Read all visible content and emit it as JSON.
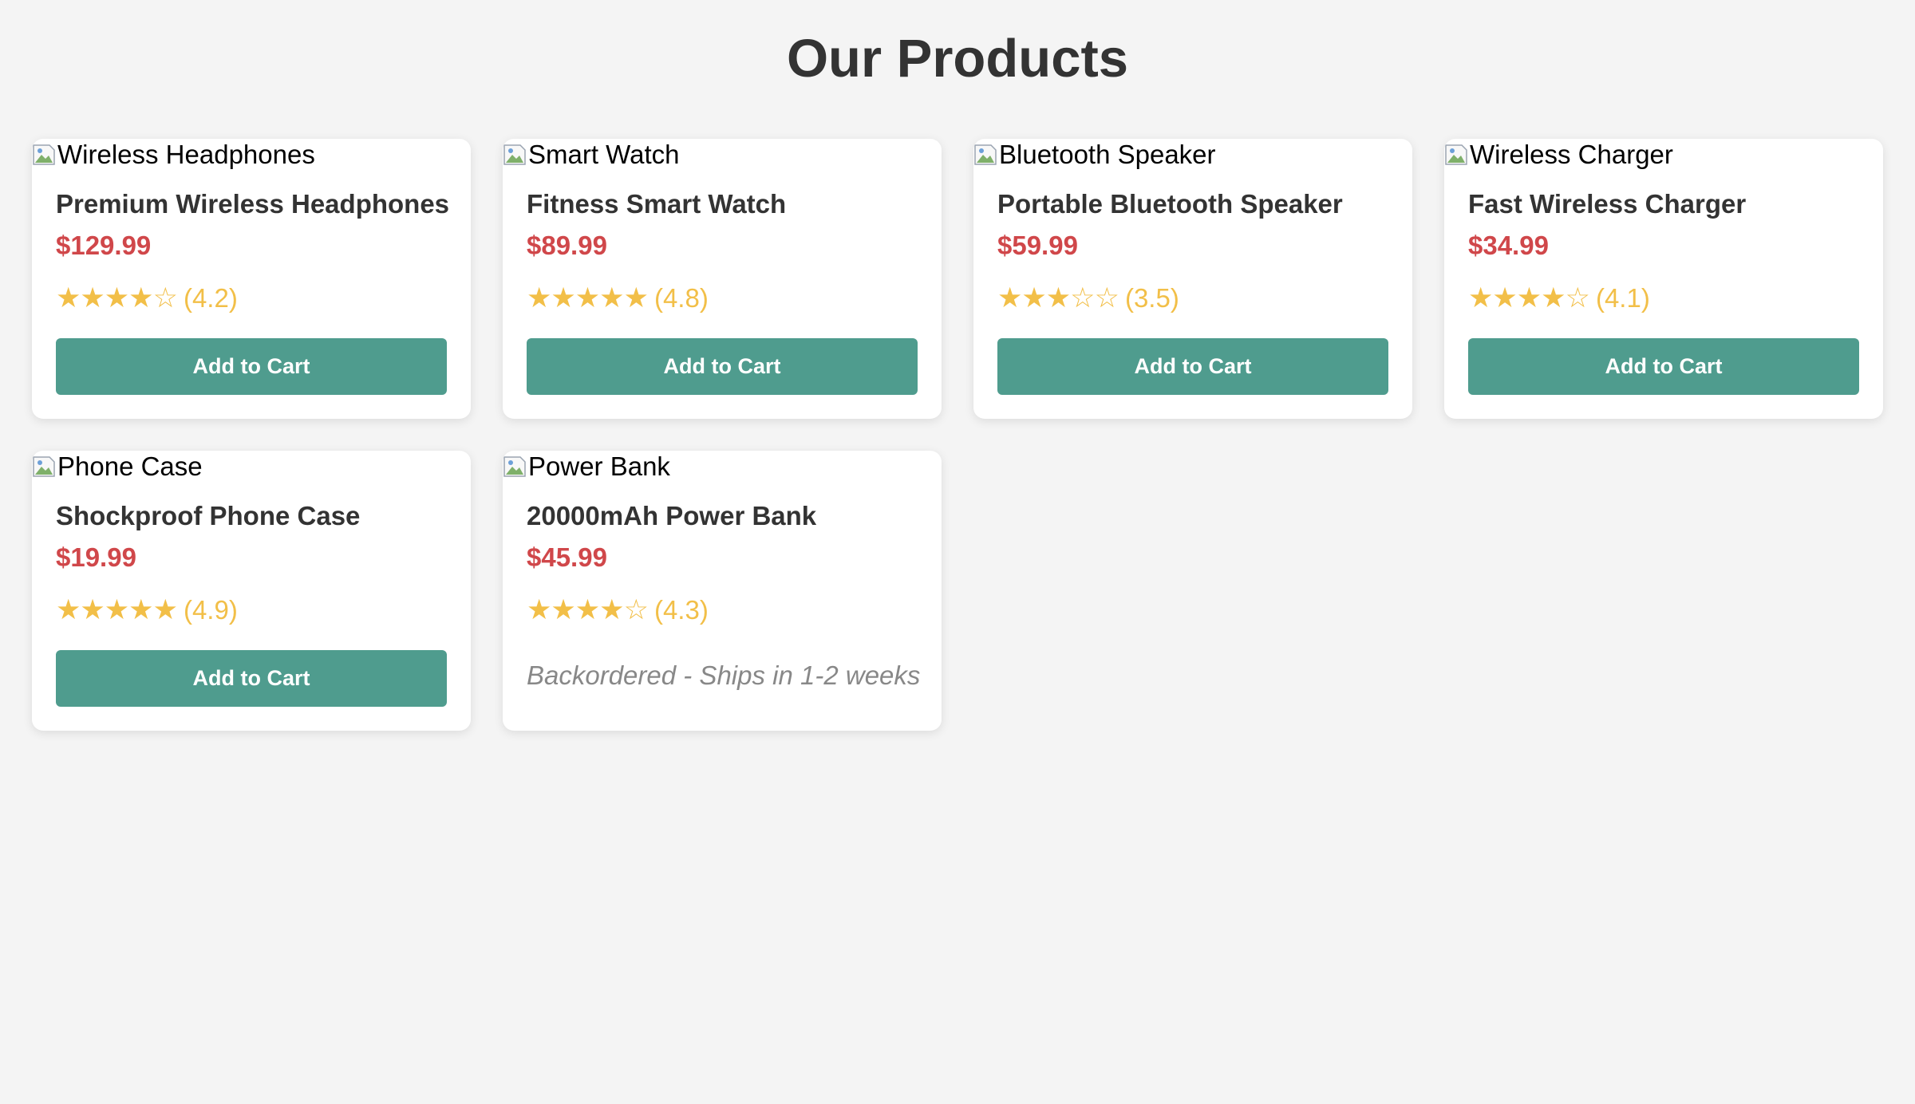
{
  "page": {
    "title": "Our Products"
  },
  "theme": {
    "background": "#f4f4f4",
    "card_background": "#ffffff",
    "price_color": "#d0474a",
    "star_color": "#f2bf48",
    "button_color": "#4f9c8e",
    "muted_text_color": "#888888"
  },
  "products": [
    {
      "image_alt": "Wireless Headphones",
      "name": "Premium Wireless Headphones",
      "price": "$129.99",
      "rating": 4.2,
      "rating_label": "(4.2)",
      "stars_filled": 4,
      "stars_total": 5,
      "action_label": "Add to Cart",
      "status": ""
    },
    {
      "image_alt": "Smart Watch",
      "name": "Fitness Smart Watch",
      "price": "$89.99",
      "rating": 4.8,
      "rating_label": "(4.8)",
      "stars_filled": 5,
      "stars_total": 5,
      "action_label": "Add to Cart",
      "status": ""
    },
    {
      "image_alt": "Bluetooth Speaker",
      "name": "Portable Bluetooth Speaker",
      "price": "$59.99",
      "rating": 3.5,
      "rating_label": "(3.5)",
      "stars_filled": 3,
      "stars_total": 5,
      "action_label": "Add to Cart",
      "status": ""
    },
    {
      "image_alt": "Wireless Charger",
      "name": "Fast Wireless Charger",
      "price": "$34.99",
      "rating": 4.1,
      "rating_label": "(4.1)",
      "stars_filled": 4,
      "stars_total": 5,
      "action_label": "Add to Cart",
      "status": ""
    },
    {
      "image_alt": "Phone Case",
      "name": "Shockproof Phone Case",
      "price": "$19.99",
      "rating": 4.9,
      "rating_label": "(4.9)",
      "stars_filled": 5,
      "stars_total": 5,
      "action_label": "Add to Cart",
      "status": ""
    },
    {
      "image_alt": "Power Bank",
      "name": "20000mAh Power Bank",
      "price": "$45.99",
      "rating": 4.3,
      "rating_label": "(4.3)",
      "stars_filled": 4,
      "stars_total": 5,
      "action_label": "",
      "status": "Backordered - Ships in 1-2 weeks"
    }
  ],
  "icons": {
    "image": "broken-image-icon",
    "star_filled": "star-filled-icon",
    "star_empty": "star-empty-icon"
  }
}
